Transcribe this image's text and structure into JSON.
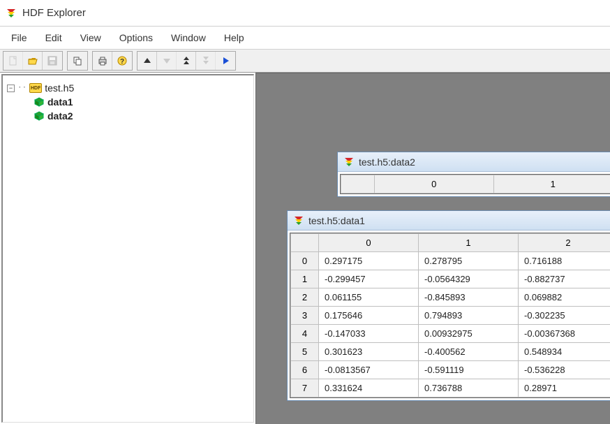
{
  "app": {
    "title": "HDF Explorer"
  },
  "menu": {
    "file": "File",
    "edit": "Edit",
    "view": "View",
    "options": "Options",
    "window": "Window",
    "help": "Help"
  },
  "tree": {
    "file": "test.h5",
    "datasets": [
      "data1",
      "data2"
    ]
  },
  "windows": {
    "data2": {
      "title": "test.h5:data2",
      "columns": [
        "0",
        "1"
      ]
    },
    "data1": {
      "title": "test.h5:data1",
      "columns": [
        "0",
        "1",
        "2"
      ],
      "rows": [
        {
          "i": "0",
          "v": [
            "0.297175",
            "0.278795",
            "0.716188"
          ]
        },
        {
          "i": "1",
          "v": [
            "-0.299457",
            "-0.0564329",
            "-0.882737"
          ]
        },
        {
          "i": "2",
          "v": [
            "0.061155",
            "-0.845893",
            "0.069882"
          ]
        },
        {
          "i": "3",
          "v": [
            "0.175646",
            "0.794893",
            "-0.302235"
          ]
        },
        {
          "i": "4",
          "v": [
            "-0.147033",
            "0.00932975",
            "-0.00367368"
          ]
        },
        {
          "i": "5",
          "v": [
            "0.301623",
            "-0.400562",
            "0.548934"
          ]
        },
        {
          "i": "6",
          "v": [
            "-0.0813567",
            "-0.591119",
            "-0.536228"
          ]
        },
        {
          "i": "7",
          "v": [
            "0.331624",
            "0.736788",
            "0.28971"
          ]
        }
      ]
    }
  }
}
